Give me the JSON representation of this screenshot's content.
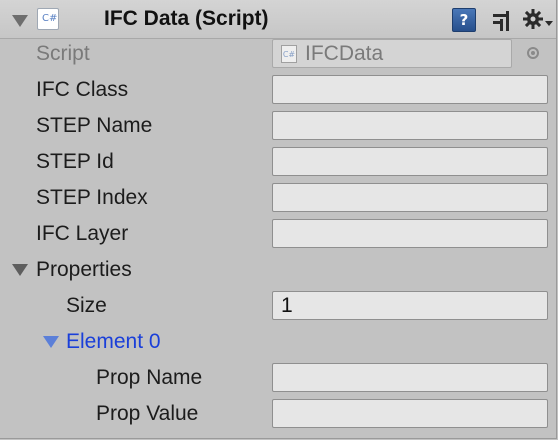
{
  "component": {
    "title": "IFC Data (Script)",
    "script_icon_text": "C#",
    "help_icon_text": "?"
  },
  "script_row": {
    "label": "Script",
    "value": "IFCData"
  },
  "fields": [
    {
      "label": "IFC Class",
      "value": ""
    },
    {
      "label": "STEP Name",
      "value": ""
    },
    {
      "label": "STEP Id",
      "value": ""
    },
    {
      "label": "STEP Index",
      "value": ""
    },
    {
      "label": "IFC Layer",
      "value": ""
    }
  ],
  "properties": {
    "label": "Properties",
    "size_label": "Size",
    "size_value": "1",
    "element": {
      "label": "Element 0",
      "prop_name_label": "Prop Name",
      "prop_name_value": "",
      "prop_value_label": "Prop Value",
      "prop_value_value": ""
    }
  },
  "colors": {
    "background": "#c2c2c2",
    "foldout_blue": "#1a3fd9",
    "help_icon_blue": "#3a66a8"
  },
  "icons": [
    "foldout-arrow-icon",
    "csharp-script-icon",
    "help-icon",
    "preset-icon",
    "gear-icon",
    "object-picker-icon"
  ]
}
